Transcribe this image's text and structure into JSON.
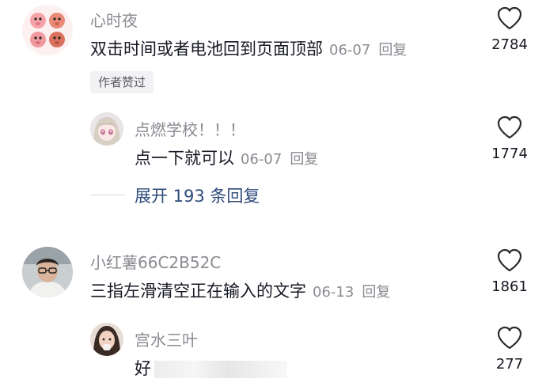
{
  "comments": [
    {
      "username": "心时夜",
      "text": "双击时间或者电池回到页面顶部",
      "date": "06-07",
      "reply_label": "回复",
      "likes": "2784",
      "badge": "作者赞过",
      "avatar_icon": "cartoon-pig-faces-avatar",
      "replies": [
        {
          "username": "点燃学校！！！",
          "text": "点一下就可以",
          "date": "06-07",
          "reply_label": "回复",
          "likes": "1774",
          "avatar_icon": "anime-girl-avatar"
        }
      ],
      "expand_label": "展开 193 条回复"
    },
    {
      "username": "小红薯66C2B52C",
      "text": "三指左滑清空正在输入的文字",
      "date": "06-13",
      "reply_label": "回复",
      "likes": "1861",
      "avatar_icon": "man-with-glasses-avatar",
      "replies": [
        {
          "username": "宫水三叶",
          "text": "好",
          "likes": "277",
          "avatar_icon": "woman-photo-avatar"
        }
      ]
    }
  ],
  "colors": {
    "primary_text": "#161823",
    "secondary_text": "#8a8b91",
    "expand_link": "#2d4a7a",
    "badge_bg": "#f2f2f4"
  }
}
